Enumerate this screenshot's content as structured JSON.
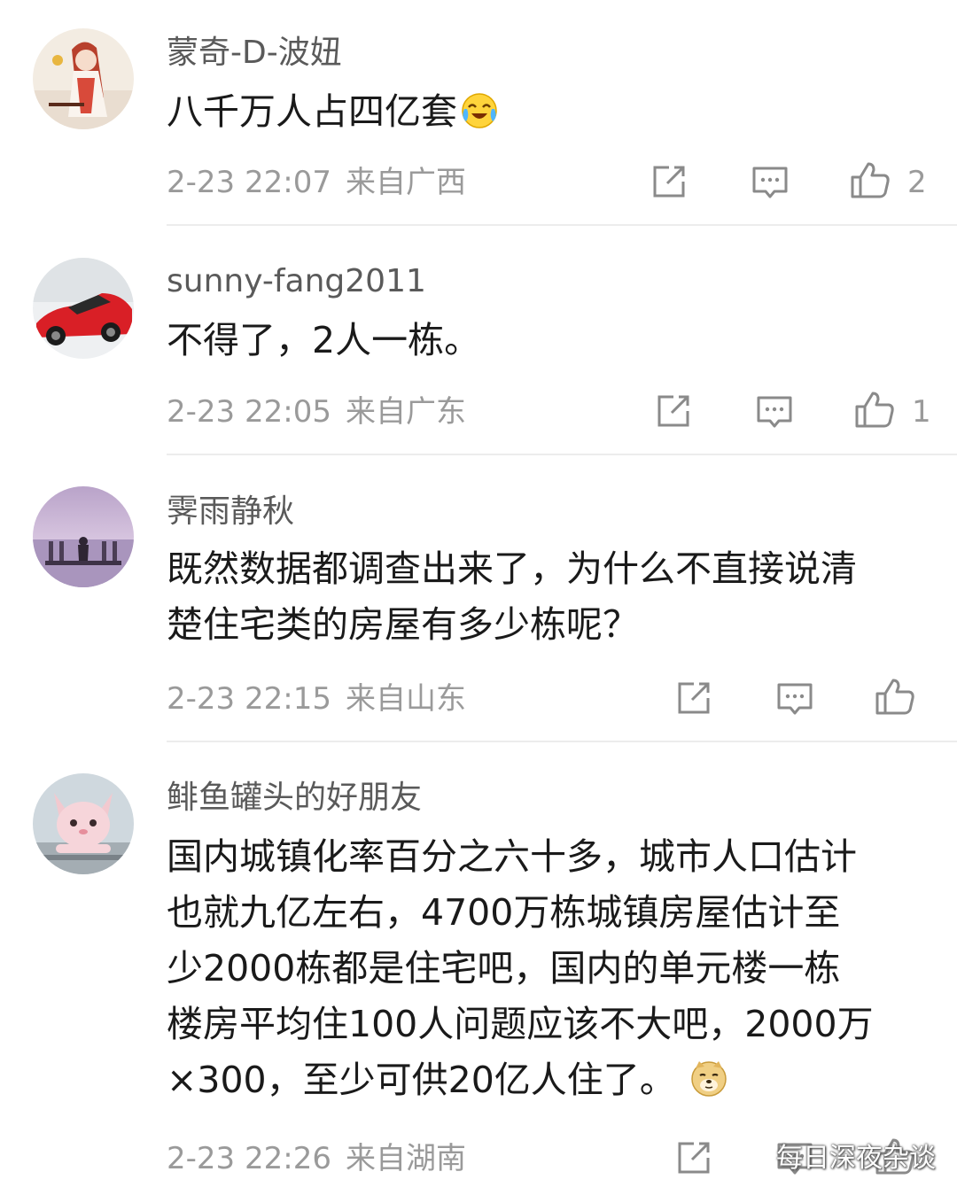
{
  "comments": [
    {
      "username": "蒙奇-D-波妞",
      "text": "八千万人占四亿套",
      "emoji": "crying-laughing-emoji",
      "time": "2-23 22:07",
      "region": "来自广西",
      "likes": "2"
    },
    {
      "username": "sunny-fang2011",
      "text": "不得了，2人一栋。",
      "time": "2-23 22:05",
      "region": "来自广东",
      "likes": "1"
    },
    {
      "username": "霁雨静秋",
      "text_lines": [
        "既然数据都调查出来了，为什么不直接说清",
        "楚住宅类的房屋有多少栋呢？"
      ],
      "time": "2-23 22:15",
      "region": "来自山东",
      "likes": ""
    },
    {
      "username": "鲱鱼罐头的好朋友",
      "text_lines": [
        "国内城镇化率百分之六十多，城市人口估计",
        "也就九亿左右，4700万栋城镇房屋估计至",
        "少2000栋都是住宅吧，国内的单元楼一栋",
        "楼房平均住100人问题应该不大吧，2000万",
        "×300，至少可供20亿人住了。"
      ],
      "emoji": "doge-emoji",
      "time": "2-23 22:26",
      "region": "来自湖南",
      "likes": ""
    }
  ],
  "icons": {
    "share": "share-icon",
    "reply": "comment-icon",
    "like": "thumbs-up-icon"
  },
  "watermark": {
    "text": "每日深夜杂谈",
    "icon": "wechat-icon"
  },
  "colors": {
    "username": "#5a5a5a",
    "text": "#1a1a1a",
    "meta": "#9a9a9a",
    "icon": "#8a8a8a",
    "divider": "#ececec"
  }
}
